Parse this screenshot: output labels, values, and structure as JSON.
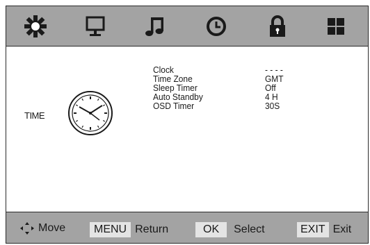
{
  "tabs": [
    {
      "icon": "picture-icon"
    },
    {
      "icon": "screen-icon"
    },
    {
      "icon": "music-note-icon"
    },
    {
      "icon": "clock-icon"
    },
    {
      "icon": "lock-icon"
    },
    {
      "icon": "grid-icon"
    }
  ],
  "section": {
    "label": "TIME",
    "icon": "analog-clock-icon"
  },
  "menu": [
    {
      "label": "Clock",
      "value": "- - - -"
    },
    {
      "label": "Time Zone",
      "value": "GMT"
    },
    {
      "label": "Sleep Timer",
      "value": "Off"
    },
    {
      "label": "Auto Standby",
      "value": "4 H"
    },
    {
      "label": "OSD Timer",
      "value": "30S"
    }
  ],
  "footer": {
    "move_icon": "dpad-arrows-icon",
    "move_label": "Move",
    "menu_key": "MENU",
    "return_label": "Return",
    "ok_key": "OK",
    "select_label": "Select",
    "exit_key": "EXIT",
    "exit_label": "Exit"
  },
  "colors": {
    "bar": "#a3a3a3",
    "key_bg": "#e4e4e4",
    "icon": "#1a1a1a"
  }
}
